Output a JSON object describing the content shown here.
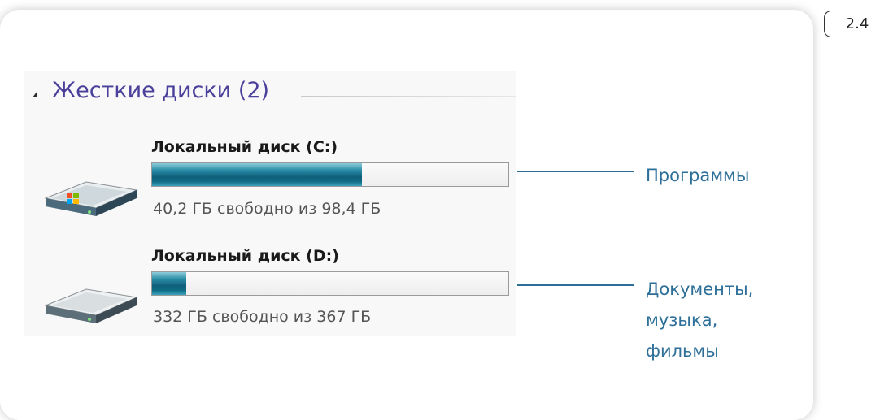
{
  "figure_number": "2.4",
  "section": {
    "title": "Жесткие диски (2)"
  },
  "disks": [
    {
      "name": "Локальный диск (C:)",
      "free_text": "40,2 ГБ свободно из 98,4 ГБ",
      "used_fraction": 0.59,
      "icon": "hard-drive-windows-icon"
    },
    {
      "name": "Локальный диск (D:)",
      "free_text": "332 ГБ свободно из 367 ГБ",
      "used_fraction": 0.095,
      "icon": "hard-drive-icon"
    }
  ],
  "callouts": {
    "c": {
      "lines": [
        "Программы"
      ]
    },
    "d": {
      "lines": [
        "Документы,",
        "музыка,",
        "фильмы"
      ]
    }
  },
  "colors": {
    "accent": "#2d6f99",
    "section_title": "#4a3f9a",
    "usage_bar": "#0e5f7b"
  }
}
